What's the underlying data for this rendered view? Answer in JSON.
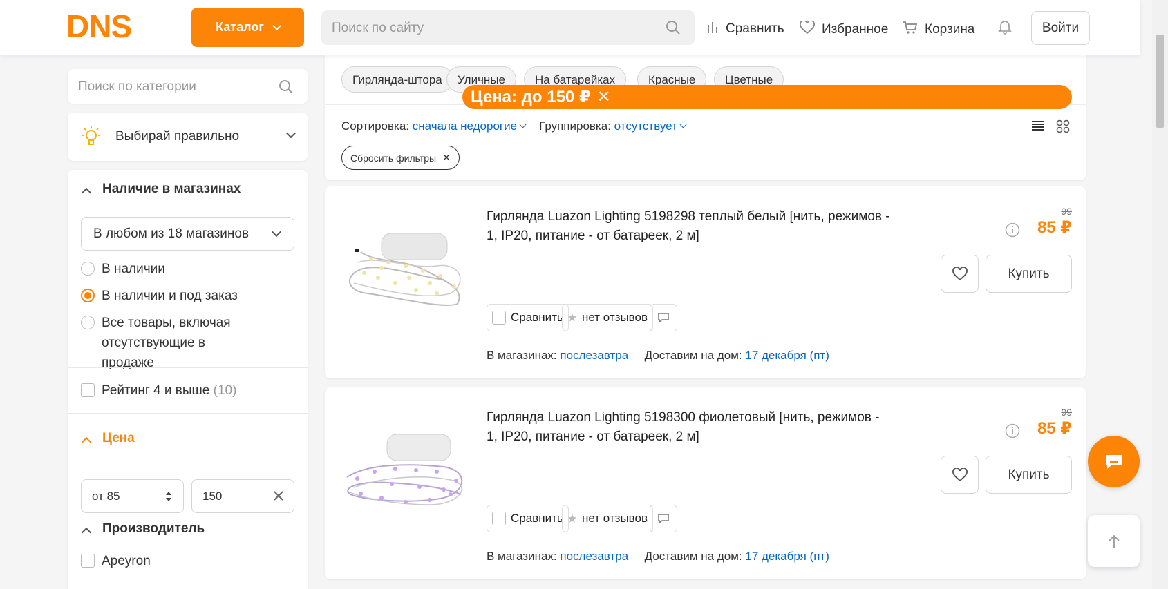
{
  "header": {
    "logo_text": "DNS",
    "catalog_label": "Каталог",
    "search_placeholder": "Поиск по сайту",
    "compare_label": "Сравнить",
    "favorites_label": "Избранное",
    "cart_label": "Корзина",
    "login_label": "Войти"
  },
  "sidebar": {
    "category_search_placeholder": "Поиск по категории",
    "choose_label": "Выбирай правильно",
    "availability": {
      "title": "Наличие в магазинах",
      "store_select": "В любом из 18 магазинов",
      "options": [
        "В наличии",
        "В наличии и под заказ",
        "Все товары, включая отсутствующие в продаже"
      ],
      "selected_index": 1
    },
    "rating": {
      "label": "Рейтинг 4 и выше",
      "count": "(10)"
    },
    "price": {
      "title": "Цена",
      "from": "от 85",
      "to": "150"
    },
    "manufacturer": {
      "title": "Производитель",
      "first_item": "Apeyron"
    }
  },
  "toolbar": {
    "tags": [
      "Гирлянда-штора",
      "Уличные",
      "На батарейках",
      "Красные",
      "Цветные"
    ],
    "sort_label": "Сортировка:",
    "sort_value": "сначала недорогие",
    "group_label": "Группировка:",
    "group_value": "отсутствует",
    "reset_filters": "Сбросить фильтры",
    "price_chip": "Цена: до 150 ₽"
  },
  "products": [
    {
      "title": "Гирлянда Luazon Lighting 5198298 теплый белый [нить, режимов - 1, IP20, питание - от батареек, 2 м]",
      "old_price": "99",
      "price": "85 ₽",
      "buy_label": "Купить",
      "compare_label": "Сравнить",
      "reviews_label": "нет отзывов",
      "stores_label": "В магазинах:",
      "stores_value": "послезавтра",
      "delivery_label": "Доставим на дом:",
      "delivery_value": "17 декабря (пт)",
      "light_color": "#f3e3a0"
    },
    {
      "title": "Гирлянда Luazon Lighting 5198300 фиолетовый [нить, режимов - 1, IP20, питание - от батареек, 2 м]",
      "old_price": "99",
      "price": "85 ₽",
      "buy_label": "Купить",
      "compare_label": "Сравнить",
      "reviews_label": "нет отзывов",
      "stores_label": "В магазинах:",
      "stores_value": "послезавтра",
      "delivery_label": "Доставим на дом:",
      "delivery_value": "17 декабря (пт)",
      "light_color": "#c9a2f0"
    }
  ],
  "colors": {
    "accent": "#fc8507",
    "link": "#0a66c2"
  },
  "icons": [
    "search-icon",
    "compare-icon",
    "heart-icon",
    "cart-icon",
    "bell-icon",
    "bulb-icon",
    "chat-icon",
    "arrow-up-icon",
    "list-view-icon",
    "grid-view-icon",
    "star-icon",
    "info-icon",
    "comment-icon"
  ]
}
